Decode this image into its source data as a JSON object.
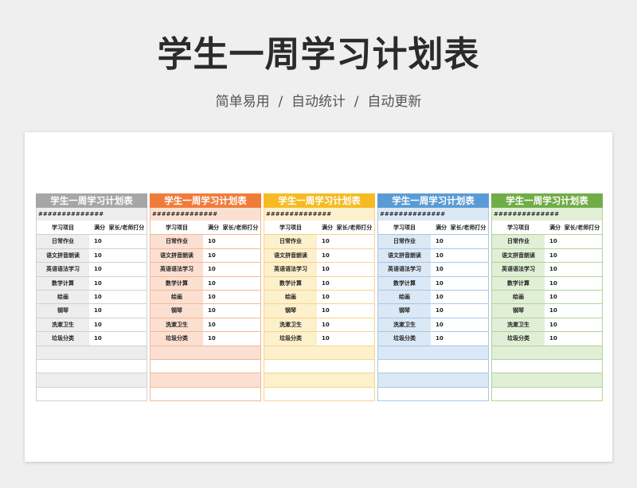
{
  "page": {
    "title": "学生一周学习计划表",
    "subtitle": "简单易用  /  自动统计  /  自动更新"
  },
  "columns": [
    "学习项目",
    "满分",
    "家长/老师打分"
  ],
  "table_title": "学生一周学习计划表",
  "hash_text": "##############",
  "rows": [
    {
      "item": "日常作业",
      "score": "10"
    },
    {
      "item": "语文拼音朗读",
      "score": "10"
    },
    {
      "item": "英语语法学习",
      "score": "10"
    },
    {
      "item": "数学计算",
      "score": "10"
    },
    {
      "item": "绘画",
      "score": "10"
    },
    {
      "item": "钢琴",
      "score": "10"
    },
    {
      "item": "洗漱卫生",
      "score": "10"
    },
    {
      "item": "垃圾分类",
      "score": "10"
    },
    {
      "item": "",
      "score": ""
    },
    {
      "item": "",
      "score": ""
    },
    {
      "item": "",
      "score": ""
    },
    {
      "item": "",
      "score": ""
    }
  ],
  "themes": [
    {
      "name": "gray",
      "head": "#a6a6a6",
      "light": "#ededed",
      "border": "#d0d0d0"
    },
    {
      "name": "orange",
      "head": "#f07c3c",
      "light": "#fbe0d2",
      "border": "#f2b89a"
    },
    {
      "name": "yellow",
      "head": "#f6bb24",
      "light": "#fdf0cc",
      "border": "#f5d58a"
    },
    {
      "name": "blue",
      "head": "#5b9bd5",
      "light": "#dbe8f5",
      "border": "#a9c7e6"
    },
    {
      "name": "green",
      "head": "#70ad47",
      "light": "#e0efd6",
      "border": "#b2d49b"
    }
  ]
}
